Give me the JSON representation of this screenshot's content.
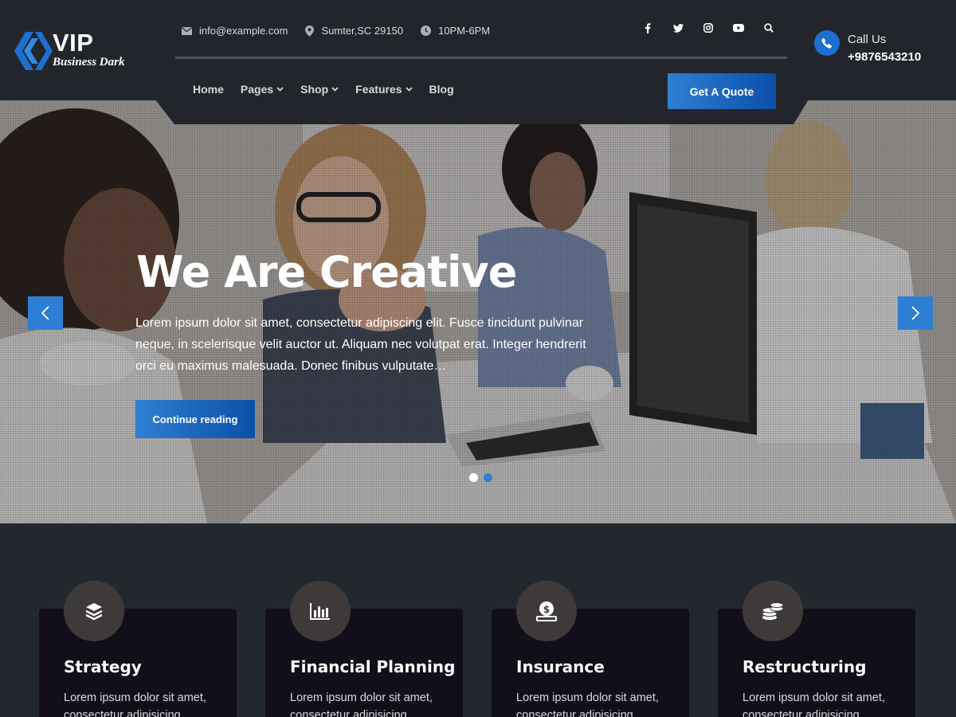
{
  "brand": {
    "name": "VIP",
    "tagline": "Business Dark"
  },
  "topbar": {
    "email": "info@example.com",
    "location": "Sumter,SC 29150",
    "hours": "10PM-6PM",
    "socials": [
      "facebook-icon",
      "twitter-icon",
      "instagram-icon",
      "youtube-icon",
      "search-icon"
    ]
  },
  "call": {
    "label": "Call Us",
    "number": "+9876543210"
  },
  "nav": {
    "items": [
      {
        "label": "Home",
        "dropdown": false
      },
      {
        "label": "Pages",
        "dropdown": true
      },
      {
        "label": "Shop",
        "dropdown": true
      },
      {
        "label": "Features",
        "dropdown": true
      },
      {
        "label": "Blog",
        "dropdown": false
      }
    ],
    "cta": "Get A Quote"
  },
  "hero": {
    "title": "We Are Creative",
    "text": "Lorem ipsum dolor sit amet, consectetur adipiscing elit. Fusce tincidunt pulvinar neque, in scelerisque velit auctor ut. Aliquam nec volutpat erat. Integer hendrerit orci eu maximus malesuada. Donec finibus vulputate…",
    "button": "Continue reading",
    "slides": 2,
    "active_slide": 1
  },
  "services": [
    {
      "title": "Strategy",
      "text": "Lorem ipsum dolor sit amet, consectetur adipisicing",
      "icon": "layers-icon"
    },
    {
      "title": "Financial Planning",
      "text": "Lorem ipsum dolor sit amet, consectetur adipisicing",
      "icon": "bar-chart-icon"
    },
    {
      "title": "Insurance",
      "text": "Lorem ipsum dolor sit amet, consectetur adipisicing",
      "icon": "money-bag-icon"
    },
    {
      "title": "Restructuring",
      "text": "Lorem ipsum dolor sit amet, consectetur adipisicing",
      "icon": "coins-icon"
    }
  ],
  "colors": {
    "accent": "#2d7fd4",
    "header_bg": "#22262c",
    "card_bg": "#120f1a",
    "icon_circle": "#3e3a3a"
  }
}
